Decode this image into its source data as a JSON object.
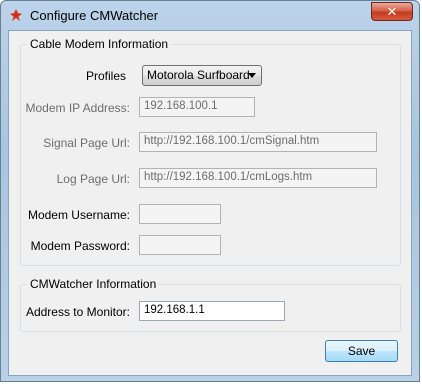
{
  "window": {
    "title": "Configure CMWatcher",
    "close_label": "✕"
  },
  "modem_group": {
    "title": "Cable Modem Information",
    "profiles_label": "Profiles",
    "profiles_selected": "Motorola Surfboard",
    "ip_label": "Modem IP Address:",
    "ip_value": "192.168.100.1",
    "signal_label": "Signal Page Url:",
    "signal_value": "http://192.168.100.1/cmSignal.htm",
    "log_label": "Log Page Url:",
    "log_value": "http://192.168.100.1/cmLogs.htm",
    "username_label": "Modem Username:",
    "username_value": "",
    "password_label": "Modem Password:",
    "password_value": ""
  },
  "watcher_group": {
    "title": "CMWatcher Information",
    "address_label": "Address to Monitor:",
    "address_value": "192.168.1.1"
  },
  "actions": {
    "save_label": "Save"
  },
  "colors": {
    "accent": "#3c7fb1",
    "disabled_text": "#6d6d6d"
  }
}
